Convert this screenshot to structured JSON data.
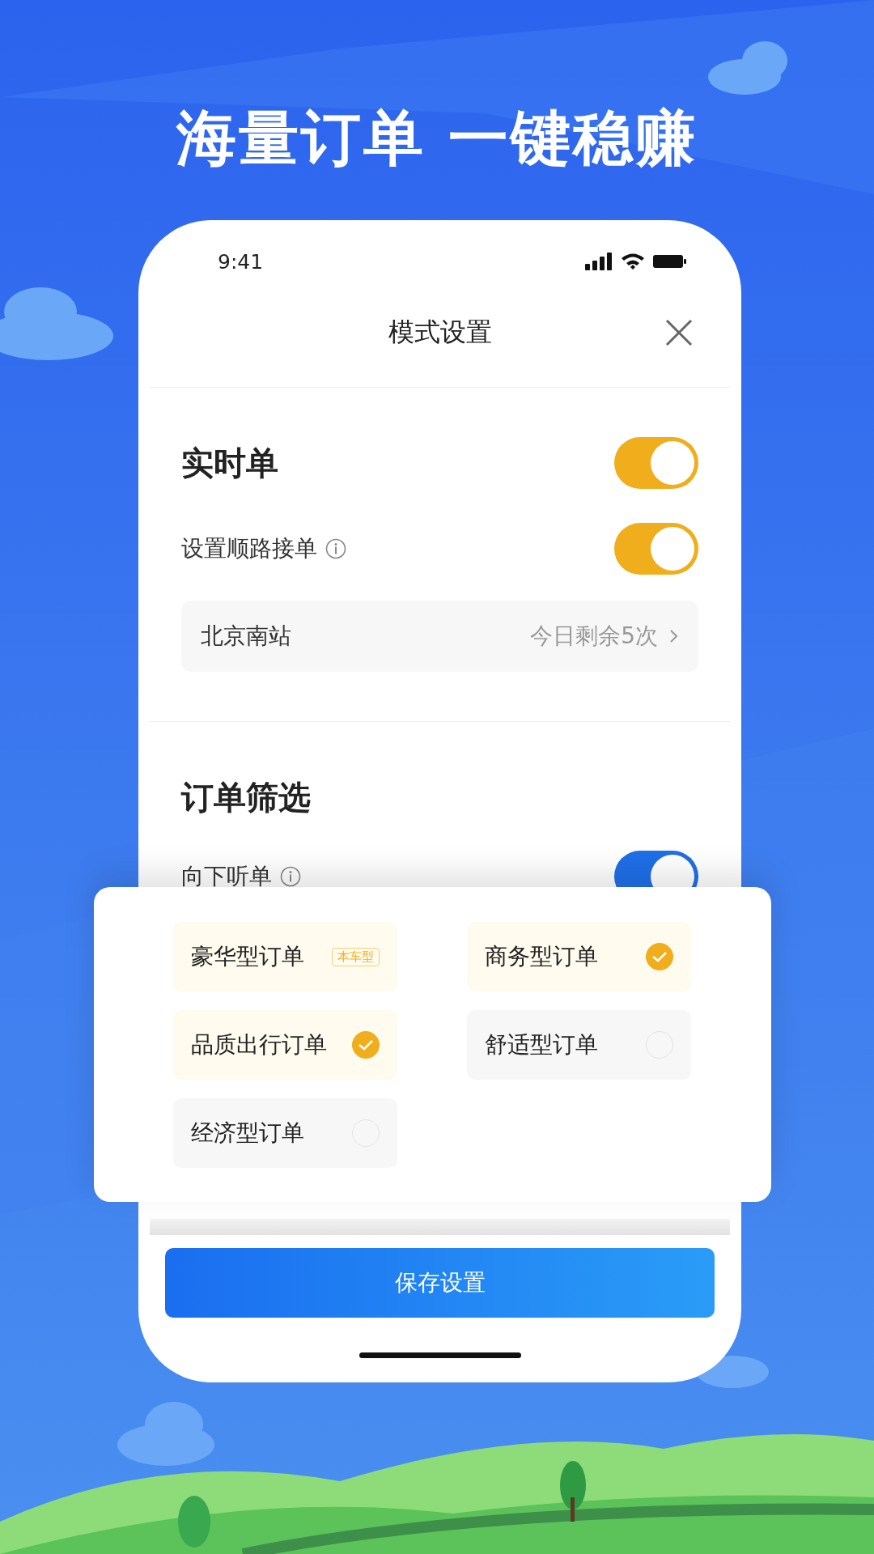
{
  "headline": "海量订单 一键稳赚",
  "status_bar": {
    "time": "9:41"
  },
  "header": {
    "title": "模式设置"
  },
  "realtime": {
    "title": "实时单",
    "on": true
  },
  "route_setting": {
    "label": "设置顺路接单",
    "on": true
  },
  "route": {
    "station": "北京南站",
    "remaining": "今日剩余5次"
  },
  "filter": {
    "title": "订单筛选"
  },
  "listen_down": {
    "label": "向下听单",
    "on": true
  },
  "order_types": [
    {
      "kind": "tag",
      "label": "豪华型订单",
      "tag": "本车型"
    },
    {
      "kind": "check",
      "label": "商务型订单",
      "checked": true
    },
    {
      "kind": "check",
      "label": "品质出行订单",
      "checked": true
    },
    {
      "kind": "check",
      "label": "舒适型订单",
      "checked": false
    },
    {
      "kind": "check",
      "label": "经济型订单",
      "checked": false
    }
  ],
  "save_button": "保存设置"
}
